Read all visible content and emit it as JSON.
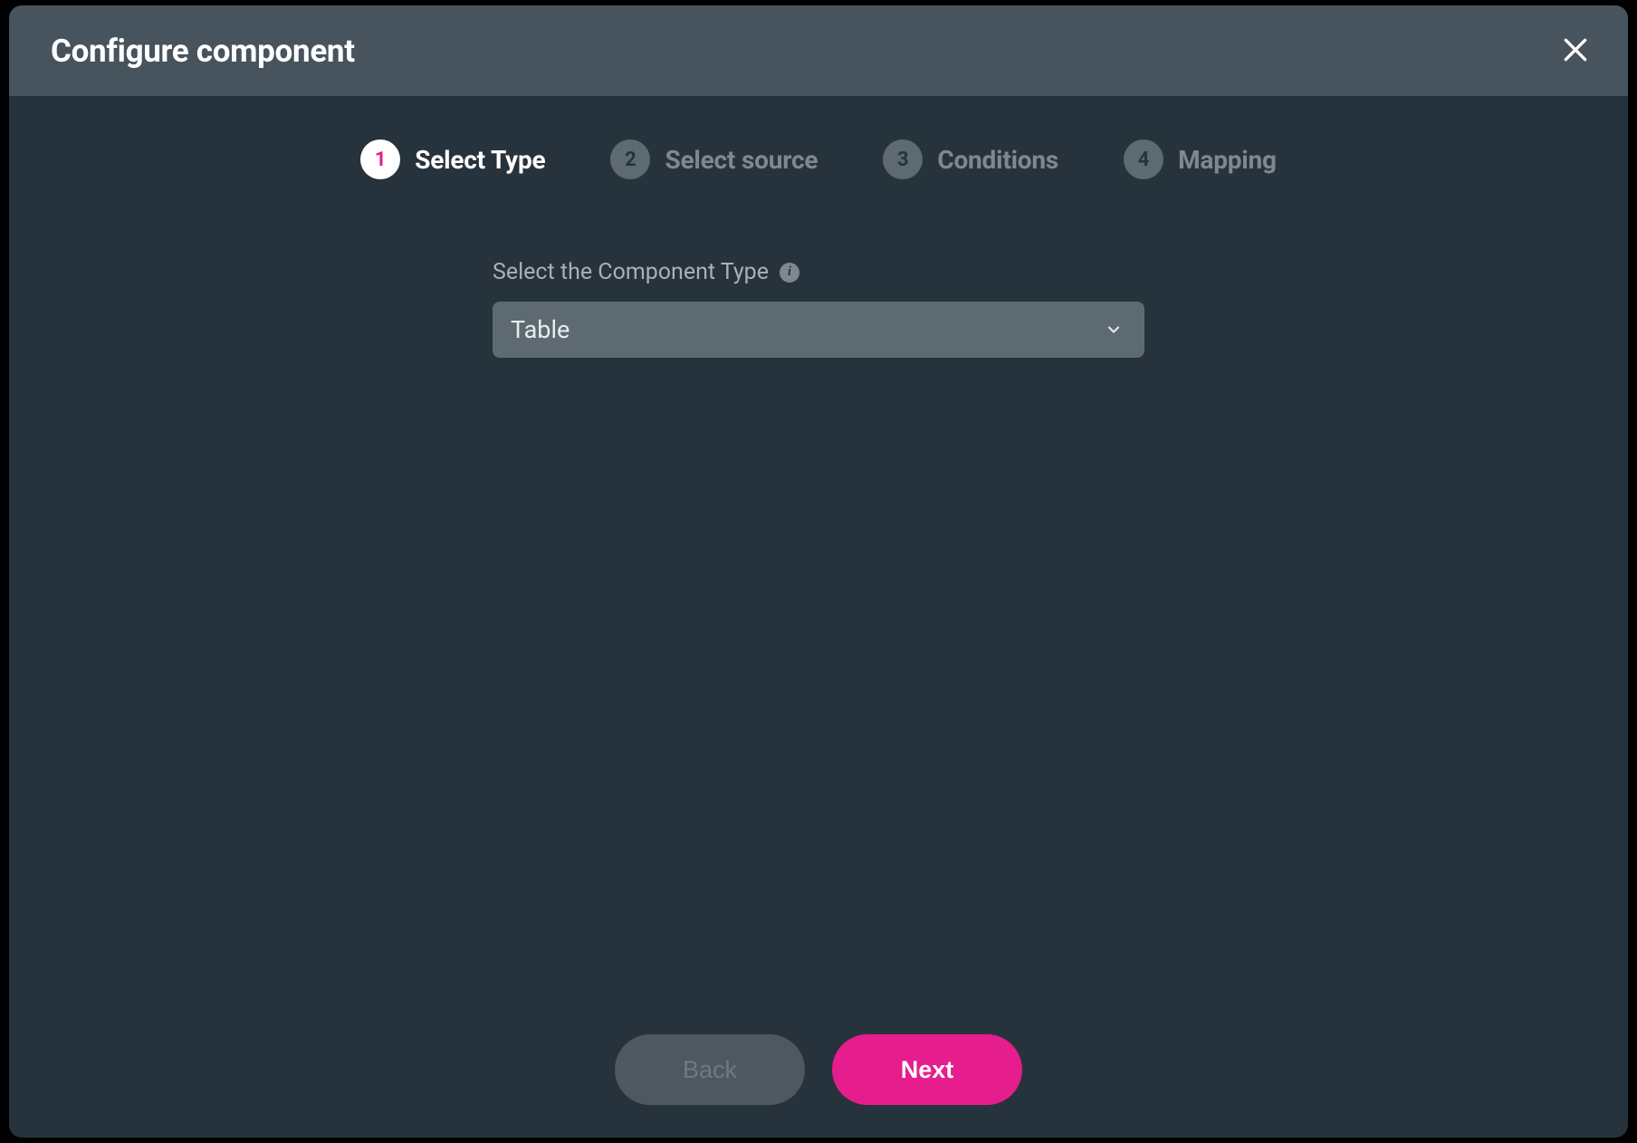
{
  "header": {
    "title": "Configure component"
  },
  "steps": [
    {
      "num": "1",
      "label": "Select Type",
      "active": true
    },
    {
      "num": "2",
      "label": "Select source",
      "active": false
    },
    {
      "num": "3",
      "label": "Conditions",
      "active": false
    },
    {
      "num": "4",
      "label": "Mapping",
      "active": false
    }
  ],
  "form": {
    "type_label": "Select the Component Type",
    "type_value": "Table",
    "info_glyph": "i"
  },
  "footer": {
    "back_label": "Back",
    "next_label": "Next"
  }
}
